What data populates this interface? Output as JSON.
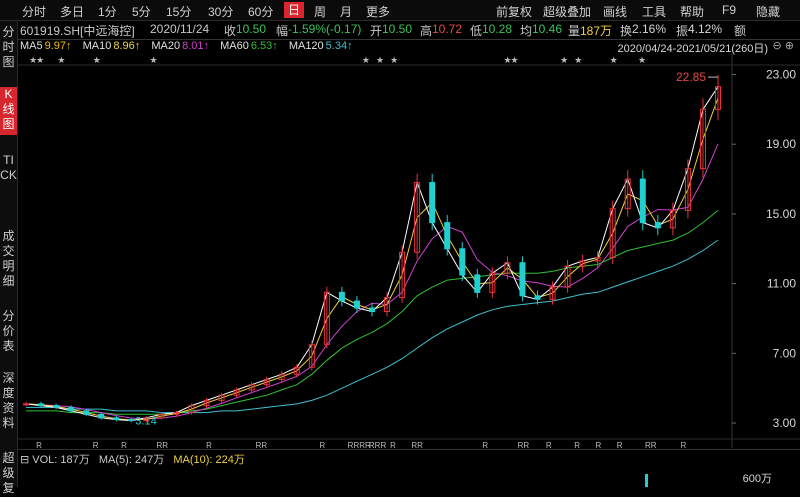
{
  "toolbar": {
    "periods": [
      "分时",
      "多日",
      "1分",
      "5分",
      "15分",
      "30分",
      "60分",
      "日",
      "周",
      "月",
      "更多"
    ],
    "active_period": "日",
    "code": "601919.SH[中远海控]",
    "date": "2020/11/24",
    "close_label": "收",
    "close_value": "10.50",
    "change_label": "幅",
    "change_value": "-1.59%(-0.17)",
    "open_label": "开",
    "open_value": "10.50",
    "high_label": "高",
    "high_value": "10.72",
    "low_label": "低",
    "low_value": "10.28",
    "avg_label": "均",
    "avg_value": "10.46",
    "volume_label": "量",
    "volume_value": "187万",
    "turnover_label": "换",
    "turnover_value": "2.16%",
    "amplitude_label": "振",
    "amplitude_value": "4.12%",
    "amount_label": "额",
    "actions": [
      "前复权",
      "超级叠加",
      "画线",
      "工具",
      "帮助",
      "F9",
      "隐藏"
    ]
  },
  "sidebar": {
    "items": [
      "分时图",
      "K线图",
      "TICK",
      "成交明细",
      "分价表",
      "深度资料",
      "超级复"
    ],
    "active": "K线图"
  },
  "ma_legend": [
    {
      "label": "MA5",
      "value": "9.97↑",
      "color": "#e0e0e0",
      "value_color": "#f0c000"
    },
    {
      "label": "MA10",
      "value": "8.96↑",
      "color": "#e0e0e0",
      "value_color": "#f0d040"
    },
    {
      "label": "MA20",
      "value": "8.01↑",
      "color": "#e0e0e0",
      "value_color": "#d040d0"
    },
    {
      "label": "MA60",
      "value": "6.53↑",
      "color": "#e0e0e0",
      "value_color": "#30c030"
    },
    {
      "label": "MA120",
      "value": "5.34↑",
      "color": "#e0e0e0",
      "value_color": "#40c0d0"
    }
  ],
  "date_range": "2020/04/24-2021/05/21(260日)",
  "chart_data": {
    "type": "line",
    "y_ticks": [
      "23.00",
      "19.00",
      "15.00",
      "11.00",
      "7.00",
      "3.00"
    ],
    "y_tick_values": [
      23,
      19,
      15,
      11,
      7,
      3
    ],
    "ylim": [
      2.2,
      23.2
    ],
    "max_label": "22.85",
    "min_label": "3.14",
    "max_value": 22.85,
    "min_value": 3.14,
    "colors": {
      "up": "#e8323c",
      "down": "#20d0d0",
      "ma5": "#ffffff",
      "ma10": "#f0d040",
      "ma20": "#d040d0",
      "ma60": "#30c030",
      "ma120": "#40c0d0"
    },
    "close": [
      4.1,
      4.0,
      3.9,
      3.7,
      3.5,
      3.3,
      3.2,
      3.14,
      3.3,
      3.5,
      3.6,
      4.0,
      4.3,
      4.6,
      4.9,
      5.2,
      5.5,
      5.8,
      6.2,
      7.5,
      10.5,
      10.0,
      9.6,
      9.4,
      10.2,
      12.8,
      16.8,
      14.5,
      13.0,
      11.5,
      10.5,
      11.6,
      12.2,
      10.3,
      10.1,
      10.8,
      12.0,
      12.3,
      12.5,
      15.3,
      17.0,
      14.5,
      14.2,
      15.2,
      17.6,
      21.0,
      22.3
    ],
    "ma60": [
      3.7,
      3.7,
      3.7,
      3.6,
      3.6,
      3.6,
      3.5,
      3.5,
      3.5,
      3.5,
      3.6,
      3.7,
      3.8,
      4.0,
      4.2,
      4.4,
      4.6,
      4.9,
      5.2,
      5.8,
      6.6,
      7.3,
      7.8,
      8.2,
      8.7,
      9.4,
      10.3,
      10.8,
      11.2,
      11.3,
      11.4,
      11.5,
      11.6,
      11.6,
      11.6,
      11.7,
      11.9,
      12.0,
      12.1,
      12.5,
      12.9,
      13.1,
      13.3,
      13.5,
      13.9,
      14.5,
      15.2
    ],
    "ma120": [
      3.9,
      3.9,
      3.9,
      3.8,
      3.8,
      3.8,
      3.7,
      3.7,
      3.7,
      3.6,
      3.6,
      3.6,
      3.6,
      3.7,
      3.7,
      3.8,
      3.9,
      4.0,
      4.1,
      4.3,
      4.6,
      5.0,
      5.4,
      5.8,
      6.2,
      6.7,
      7.3,
      7.9,
      8.4,
      8.8,
      9.2,
      9.5,
      9.7,
      9.8,
      9.9,
      10.0,
      10.2,
      10.4,
      10.5,
      10.8,
      11.1,
      11.4,
      11.7,
      12.0,
      12.4,
      12.9,
      13.5
    ],
    "star_marks": [
      "★",
      "★",
      "★",
      "★",
      "★",
      "★",
      "★",
      "★",
      "★",
      "★",
      "★",
      "★",
      "★",
      "★"
    ],
    "r_marks": [
      "R",
      "R",
      "R",
      "RR",
      "R",
      "RR",
      "R",
      "RRRR",
      "RRR",
      "R",
      "RR",
      "R",
      "RR",
      "R",
      "R",
      "R",
      "R",
      "RR",
      "R"
    ]
  },
  "volume": {
    "label_vol": "VOL:",
    "vol_value": "187万",
    "label_ma5": "MA(5):",
    "ma5_value": "247万",
    "label_ma10": "MA(10):",
    "ma10_value": "224万",
    "axis_label": "600万"
  }
}
